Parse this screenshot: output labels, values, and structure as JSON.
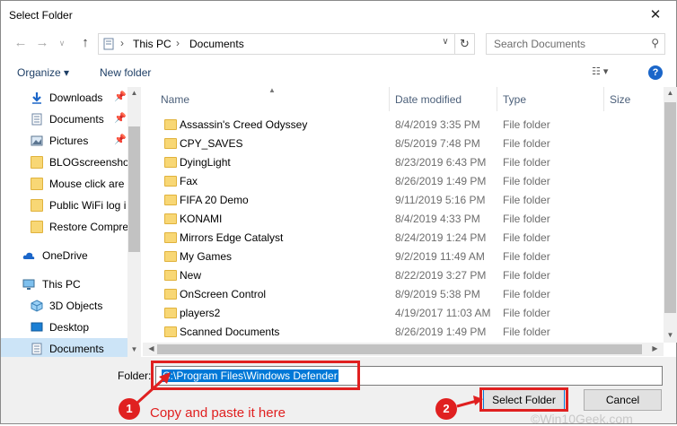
{
  "window": {
    "title": "Select Folder",
    "close_glyph": "✕"
  },
  "navbar": {
    "back_icon": "back-arrow-icon",
    "forward_icon": "forward-arrow-icon",
    "up_icon": "up-arrow-icon",
    "breadcrumbs": [
      "This PC",
      "Documents"
    ],
    "search_placeholder": "Search Documents"
  },
  "toolbar": {
    "organize_label": "Organize ▾",
    "new_folder_label": "New folder",
    "help_label": "?"
  },
  "sidebar": {
    "items": [
      {
        "label": "Downloads",
        "icon": "download-icon",
        "pinned": true
      },
      {
        "label": "Documents",
        "icon": "document-icon",
        "pinned": true
      },
      {
        "label": "Pictures",
        "icon": "pictures-icon",
        "pinned": true
      },
      {
        "label": "BLOGscreenshot",
        "icon": "folder-icon",
        "pinned": false
      },
      {
        "label": "Mouse click are",
        "icon": "folder-icon",
        "pinned": false
      },
      {
        "label": "Public WiFi log i",
        "icon": "folder-icon",
        "pinned": false
      },
      {
        "label": "Restore Compre",
        "icon": "folder-icon",
        "pinned": false
      },
      {
        "label": "OneDrive",
        "icon": "cloud-icon",
        "pinned": false
      },
      {
        "label": "This PC",
        "icon": "computer-icon",
        "pinned": false
      },
      {
        "label": "3D Objects",
        "icon": "cube-icon",
        "pinned": false
      },
      {
        "label": "Desktop",
        "icon": "desktop-icon",
        "pinned": false
      },
      {
        "label": "Documents",
        "icon": "document-icon",
        "pinned": false,
        "selected": true
      }
    ]
  },
  "columns": {
    "name": "Name",
    "date": "Date modified",
    "type": "Type",
    "size": "Size"
  },
  "files": [
    {
      "name": "Assassin's Creed Odyssey",
      "date": "8/4/2019 3:35 PM",
      "type": "File folder"
    },
    {
      "name": "CPY_SAVES",
      "date": "8/5/2019 7:48 PM",
      "type": "File folder"
    },
    {
      "name": "DyingLight",
      "date": "8/23/2019 6:43 PM",
      "type": "File folder"
    },
    {
      "name": "Fax",
      "date": "8/26/2019 1:49 PM",
      "type": "File folder"
    },
    {
      "name": "FIFA 20 Demo",
      "date": "9/11/2019 5:16 PM",
      "type": "File folder"
    },
    {
      "name": "KONAMI",
      "date": "8/4/2019 4:33 PM",
      "type": "File folder"
    },
    {
      "name": "Mirrors Edge Catalyst",
      "date": "8/24/2019 1:24 PM",
      "type": "File folder"
    },
    {
      "name": "My Games",
      "date": "9/2/2019 11:49 AM",
      "type": "File folder"
    },
    {
      "name": "New",
      "date": "8/22/2019 3:27 PM",
      "type": "File folder"
    },
    {
      "name": "OnScreen Control",
      "date": "8/9/2019 5:38 PM",
      "type": "File folder"
    },
    {
      "name": "players2",
      "date": "4/19/2017 11:03 AM",
      "type": "File folder"
    },
    {
      "name": "Scanned Documents",
      "date": "8/26/2019 1:49 PM",
      "type": "File folder"
    }
  ],
  "footer": {
    "folder_label": "Folder:",
    "folder_value": "C:\\Program Files\\Windows Defender",
    "select_button": "Select Folder",
    "cancel_button": "Cancel"
  },
  "annotations": {
    "step1": "1",
    "step1_text": "Copy and paste it here",
    "step2": "2",
    "accent_color": "#e02020",
    "watermark": "©Win10Geek.com"
  }
}
